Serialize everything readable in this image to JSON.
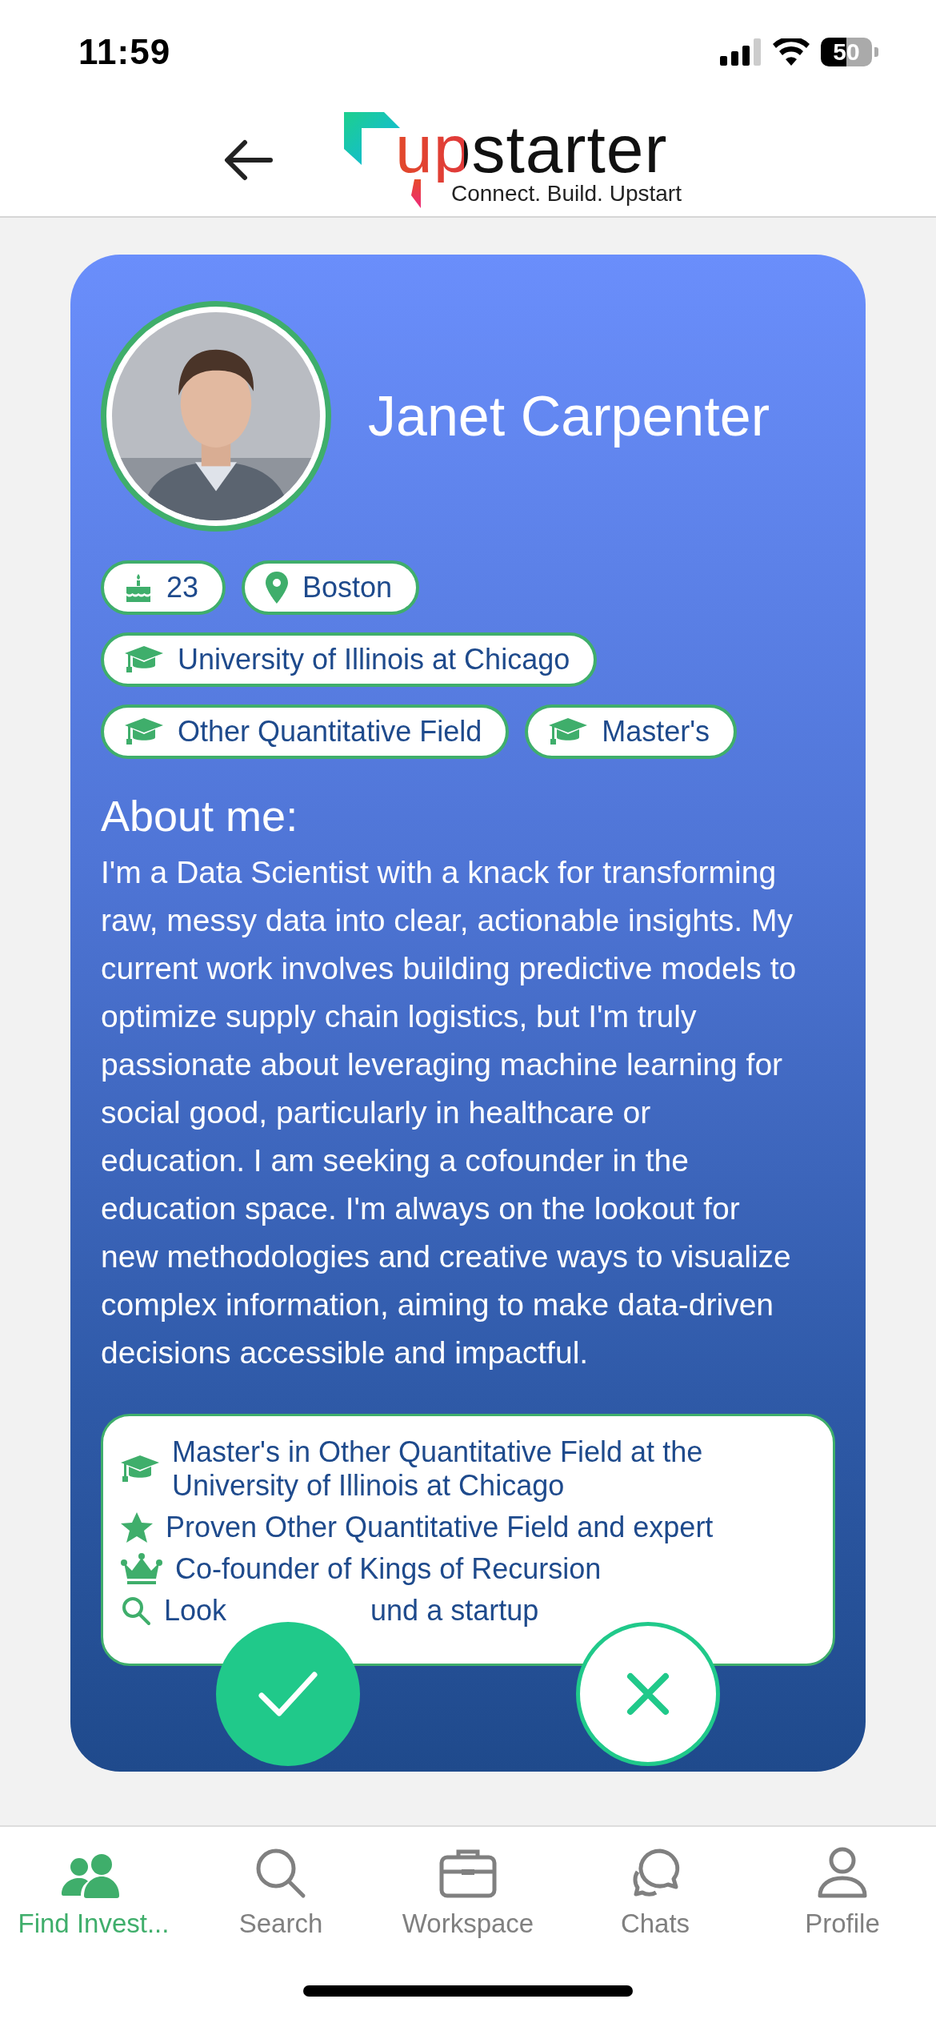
{
  "status_bar": {
    "time": "11:59",
    "battery": "50"
  },
  "header": {
    "logo": "upstarter",
    "tagline": "Connect. Build. Upstart"
  },
  "profile": {
    "name": "Janet Carpenter",
    "chips": [
      [
        {
          "kind": "age",
          "label": "23"
        },
        {
          "kind": "location",
          "label": "Boston"
        }
      ],
      [
        {
          "kind": "education",
          "label": "University of Illinois at Chicago"
        }
      ],
      [
        {
          "kind": "education",
          "label": "Other Quantitative Field"
        },
        {
          "kind": "education",
          "label": "Master's"
        }
      ]
    ],
    "about_heading": "About me:",
    "about": "I'm a Data Scientist with a knack for transforming raw, messy data into clear, actionable insights. My current work involves building predictive models to optimize supply chain logistics, but I'm truly passionate about leveraging machine learning for social good, particularly in healthcare or education. I am seeking a cofounder in the education space. I'm always on the lookout for new methodologies and creative ways to visualize complex information, aiming to make data-driven decisions accessible and impactful.",
    "highlights": [
      {
        "kind": "education",
        "parts": [
          "Master's in Other Quantitative Field at the University of Illinois at Chicago"
        ]
      },
      {
        "kind": "expertise",
        "parts": [
          "Proven Other Quantitative Field and  expert"
        ]
      },
      {
        "kind": "founder",
        "parts": [
          "Co-founder of Kings of Recursion"
        ]
      },
      {
        "kind": "seeking",
        "parts": [
          "Look",
          "und a startup"
        ]
      }
    ]
  },
  "tabs": [
    {
      "kind": "investors",
      "label": "Find Invest...",
      "selected": true
    },
    {
      "kind": "search",
      "label": "Search",
      "selected": false
    },
    {
      "kind": "workspace",
      "label": "Workspace",
      "selected": false
    },
    {
      "kind": "chats",
      "label": "Chats",
      "selected": false
    },
    {
      "kind": "profile",
      "label": "Profile",
      "selected": false
    }
  ]
}
